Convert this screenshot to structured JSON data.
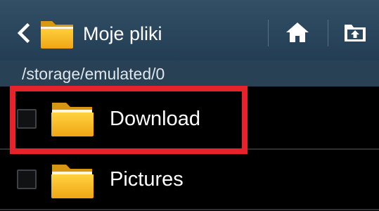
{
  "action_bar": {
    "title": "Moje pliki",
    "back_icon": "chevron-left-icon",
    "app_icon": "folder-icon",
    "home_icon": "home-icon",
    "upload_icon": "folder-upload-icon"
  },
  "path_bar": {
    "path": "/storage/emulated/0"
  },
  "file_list": {
    "items": [
      {
        "label": "Download",
        "icon": "folder-icon",
        "checked": false
      },
      {
        "label": "Pictures",
        "icon": "folder-icon",
        "checked": false
      }
    ]
  },
  "colors": {
    "action_bar": "#2b475d",
    "path_bar": "#284155",
    "list_background": "#000000",
    "highlight": "#e8222c",
    "folder": "#f2b51b"
  }
}
